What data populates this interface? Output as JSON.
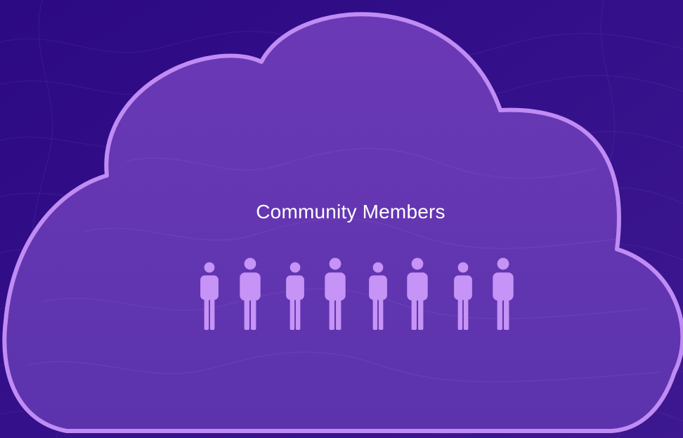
{
  "caption": "Community Members",
  "people": {
    "count": 8,
    "icon": "person-icon"
  },
  "colors": {
    "background_top": "#2f0b86",
    "background_bottom": "#3b168f",
    "cloud_fill": "#6436b3",
    "cloud_outline": "#c08cf4",
    "person_fill": "#c693f6",
    "caption_text": "#ffffff"
  }
}
